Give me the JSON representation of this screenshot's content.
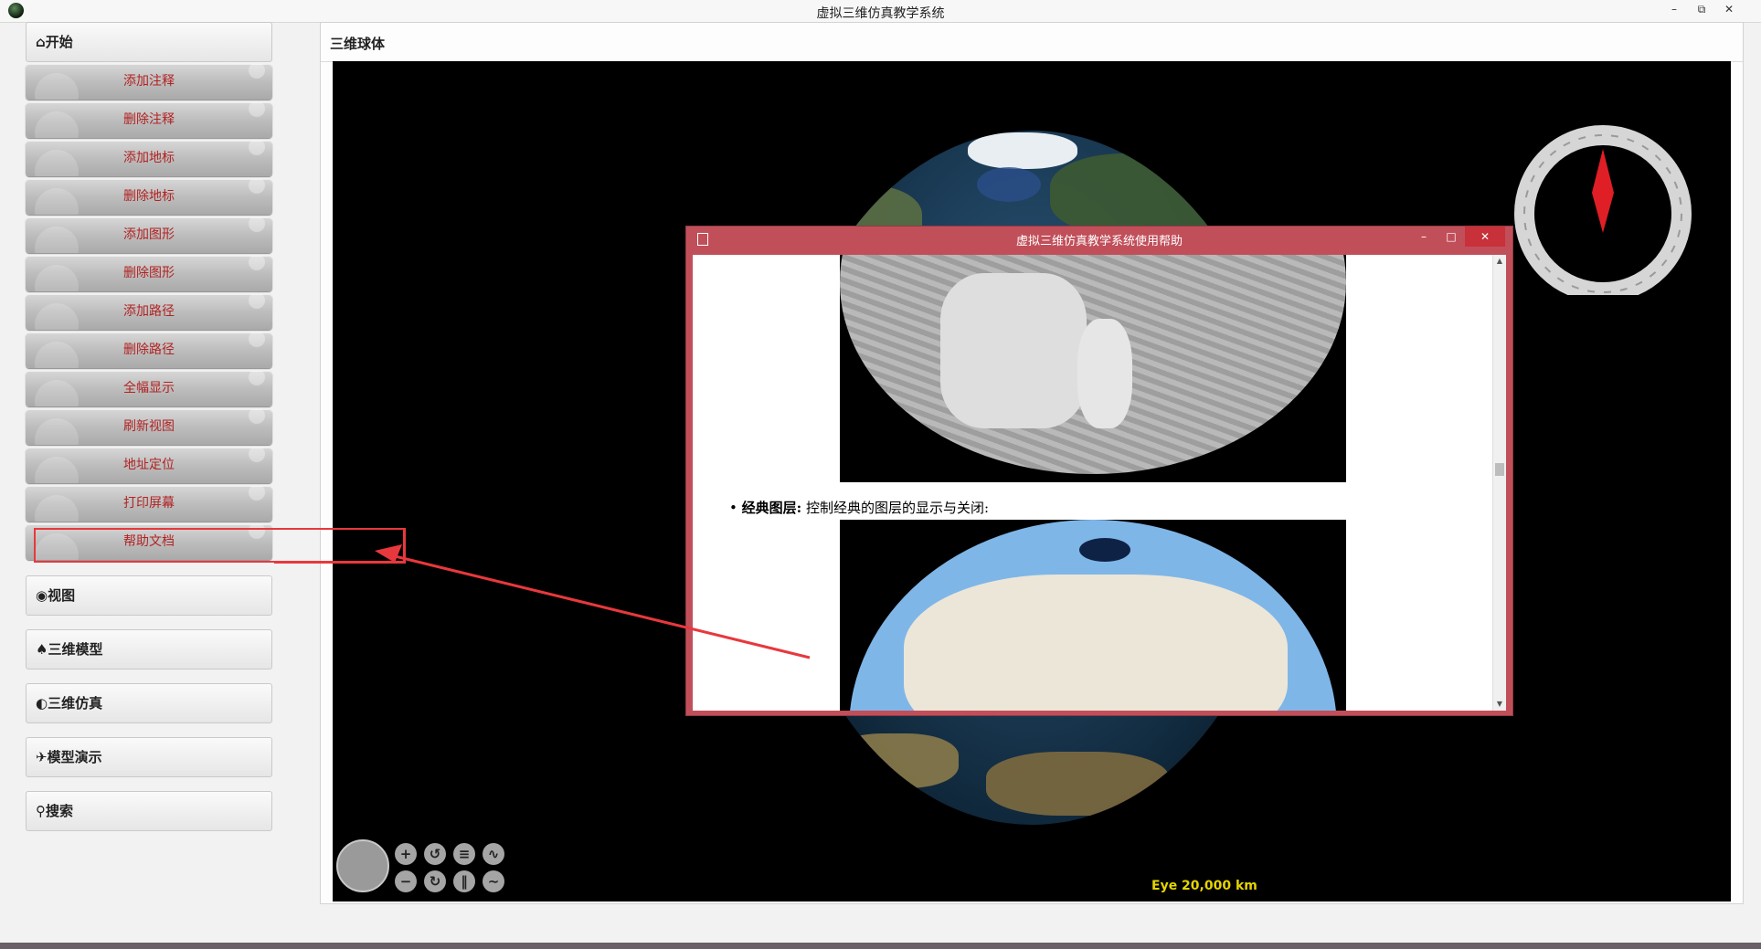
{
  "window": {
    "title": "虚拟三维仿真教学系统",
    "controls": [
      "–",
      "⧉",
      "✕"
    ]
  },
  "sidebar": {
    "start_header": "开始",
    "items": [
      {
        "label": "添加注释"
      },
      {
        "label": "删除注释"
      },
      {
        "label": "添加地标"
      },
      {
        "label": "删除地标"
      },
      {
        "label": "添加图形"
      },
      {
        "label": "删除图形"
      },
      {
        "label": "添加路径"
      },
      {
        "label": "删除路径"
      },
      {
        "label": "全幅显示"
      },
      {
        "label": "刷新视图"
      },
      {
        "label": "地址定位"
      },
      {
        "label": "打印屏幕"
      },
      {
        "label": "帮助文档"
      }
    ],
    "sections": [
      {
        "label": "视图"
      },
      {
        "label": "三维模型"
      },
      {
        "label": "三维仿真"
      },
      {
        "label": "模型演示"
      },
      {
        "label": "搜索"
      }
    ]
  },
  "main": {
    "panel_title": "三维球体",
    "eye_readout": "Eye  20,000 km"
  },
  "help_window": {
    "title": "虚拟三维仿真教学系统使用帮助",
    "bullet": "•",
    "section_bold": "经典图层:",
    "section_text": "控制经典的图层的显示与关闭:"
  },
  "colors": {
    "menu_label": "#b22222",
    "help_titlebar": "#c14f5a",
    "annotation": "#e8383d",
    "eye_text": "#e6d400"
  }
}
